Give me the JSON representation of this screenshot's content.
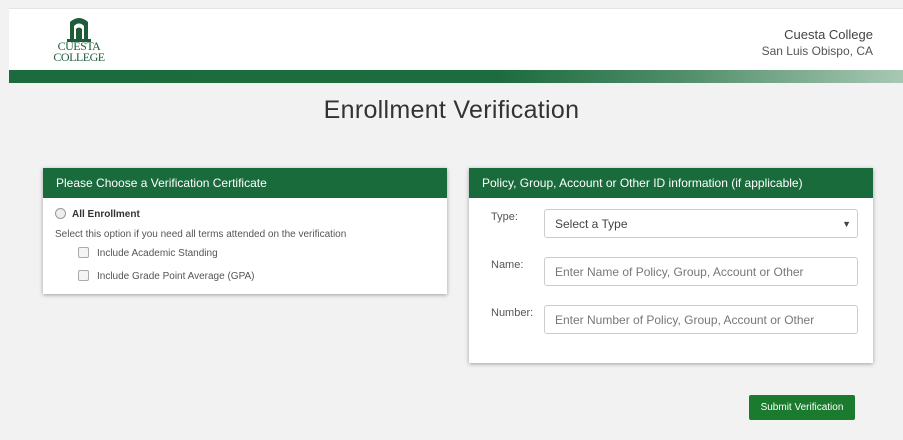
{
  "header": {
    "logo_text_line1": "CUESTA",
    "logo_text_line2": "COLLEGE",
    "college_name": "Cuesta College",
    "location": "San Luis Obispo, CA",
    "brand_color": "#1a6b3c"
  },
  "page_title": "Enrollment Verification",
  "certificate_panel": {
    "title": "Please Choose a Verification Certificate",
    "option_label": "All Enrollment",
    "option_description": "Select this option if you need all terms attended on the verification",
    "checkboxes": [
      {
        "label": "Include Academic Standing",
        "checked": false
      },
      {
        "label": "Include Grade Point Average (GPA)",
        "checked": false
      }
    ]
  },
  "id_panel": {
    "title": "Policy, Group, Account or Other ID information (if applicable)",
    "type_label": "Type:",
    "type_value": "Select a Type",
    "name_label": "Name:",
    "name_placeholder": "Enter Name of Policy, Group, Account or Other",
    "number_label": "Number:",
    "number_placeholder": "Enter Number of Policy, Group, Account or Other"
  },
  "submit_label": "Submit Verification"
}
